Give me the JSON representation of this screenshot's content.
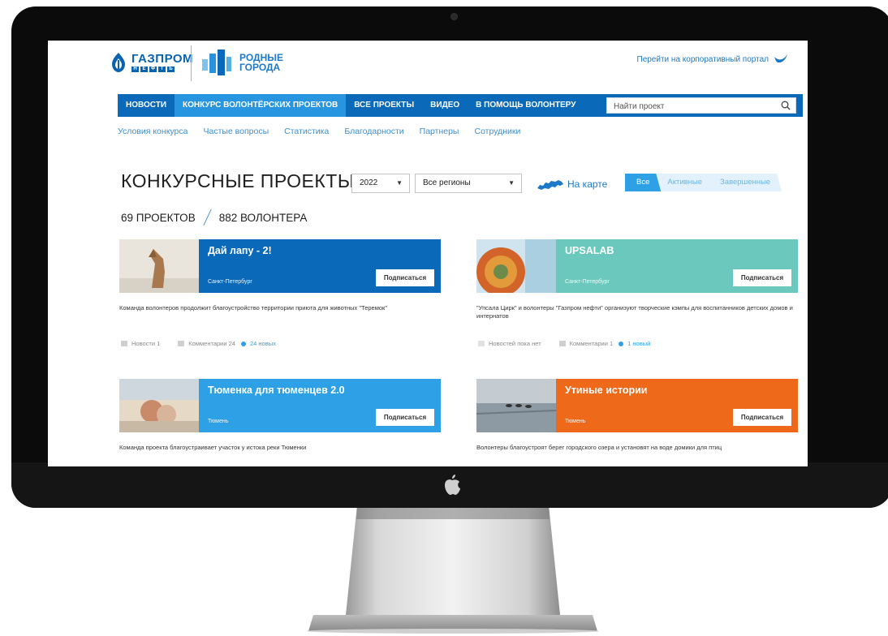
{
  "header": {
    "gazprom_name": "ГАЗПРОМ",
    "gazprom_sub": [
      "Н",
      "Е",
      "Ф",
      "Т",
      "Ь"
    ],
    "rodnye_line1": "РОДНЫЕ",
    "rodnye_line2": "ГОРОДА",
    "portal_link": "Перейти на корпоративный портал"
  },
  "nav": {
    "items": [
      "НОВОСТИ",
      "КОНКУРС ВОЛОНТЁРСКИХ ПРОЕКТОВ",
      "ВСЕ ПРОЕКТЫ",
      "ВИДЕО",
      "В ПОМОЩЬ ВОЛОНТЕРУ"
    ],
    "search_placeholder": "Найти проект"
  },
  "subnav": [
    "Условия конкурса",
    "Частые вопросы",
    "Статистика",
    "Благодарности",
    "Партнеры",
    "Сотрудники"
  ],
  "main": {
    "title": "КОНКУРСНЫЕ ПРОЕКТЫ",
    "year": "2022",
    "region": "Все регионы",
    "map_link": "На карте",
    "tabs": [
      "Все",
      "Активные",
      "Завершенные"
    ],
    "projects_count": "69 ПРОЕКТОВ",
    "volunteers_count": "882 ВОЛОНТЕРА"
  },
  "cards": [
    {
      "title": "Дай лапу - 2!",
      "city": "Санкт-Петербург",
      "button": "Подписаться",
      "desc": "Команда волонтеров продолжит благоустройство территории приюта для животных \"Теремок\"",
      "news": "Новости 1",
      "comments": "Комментарии 24",
      "new": "24 новых",
      "color": "#0a69b8"
    },
    {
      "title": "UPSALAB",
      "city": "Санкт-Петербург",
      "button": "Подписаться",
      "desc": "\"Упсала Цирк\" и волонтеры \"Газпром нефти\" организуют творческие кэмпы для воспитанников детских домов и интернатов",
      "news": "Новостей пока нет",
      "comments": "Комментарии 1",
      "new": "1 новый",
      "color": "#6ac8bc"
    },
    {
      "title": "Тюменка для тюменцев 2.0",
      "city": "Тюмень",
      "button": "Подписаться",
      "desc": "Команда проекта благоустраивает участок у истока реки Тюменки",
      "color": "#2ea1e6"
    },
    {
      "title": "Утиные истории",
      "city": "Тюмень",
      "button": "Подписаться",
      "desc": "Волонтеры благоустроят берег городского озера и установят на воде домики для птиц",
      "color": "#ee6a1a"
    }
  ]
}
